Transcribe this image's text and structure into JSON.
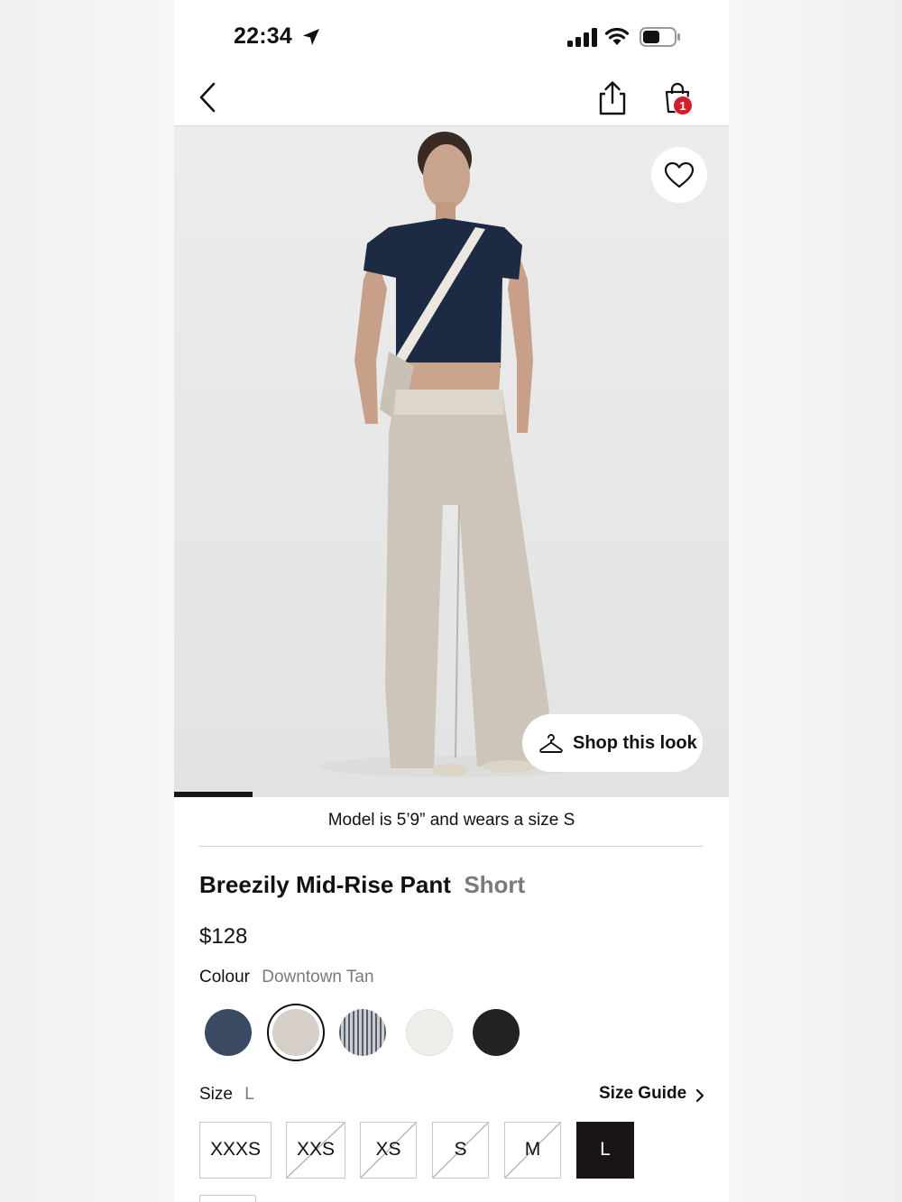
{
  "status_bar": {
    "time": "22:34"
  },
  "header": {
    "cart_count": "1"
  },
  "gallery": {
    "shop_look_label": "Shop this look",
    "progress_fraction": 0.142,
    "model_note": "Model is 5’9” and wears a size S"
  },
  "product": {
    "name": "Breezily Mid-Rise Pant",
    "fit": "Short",
    "price": "$128",
    "colour_label": "Colour",
    "colour_value": "Downtown Tan",
    "colours": [
      {
        "swatch": "#3a4a62"
      },
      {
        "swatch": "#d6cfc8",
        "selected": true
      },
      {
        "swatch": "striped-grey"
      },
      {
        "swatch": "#efeeea"
      },
      {
        "swatch": "#222222"
      }
    ],
    "size_label": "Size",
    "size_value": "L",
    "size_guide_label": "Size Guide",
    "sizes": [
      {
        "label": "XXXS",
        "available": true
      },
      {
        "label": "XXS",
        "available": false
      },
      {
        "label": "XS",
        "available": false
      },
      {
        "label": "S",
        "available": false
      },
      {
        "label": "M",
        "available": false
      },
      {
        "label": "L",
        "available": true,
        "selected": true
      }
    ]
  },
  "icons": [
    "location-arrow-icon",
    "signal-icon",
    "wifi-icon",
    "battery-icon",
    "back-chevron-icon",
    "share-icon",
    "shopping-bag-icon",
    "heart-icon",
    "hanger-icon",
    "chevron-right-icon"
  ],
  "colors": {
    "accent_dark": "#1a1414",
    "badge_red": "#d31e2b",
    "muted_text": "#7a7a7a"
  }
}
